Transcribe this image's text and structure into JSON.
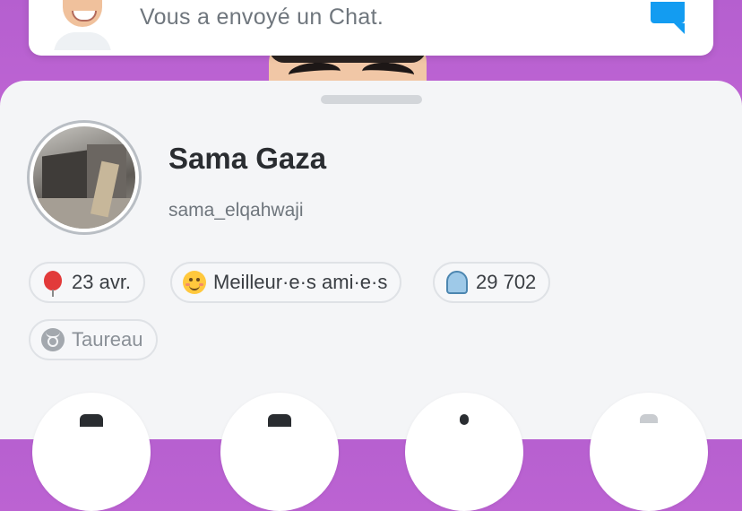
{
  "notification": {
    "text": "Vous a envoyé un Chat.",
    "icon": "chat-bubble-icon",
    "accent": "#139cf1"
  },
  "profile": {
    "display_name": "Sama Gaza",
    "username": "sama_elqahwaji"
  },
  "chips": [
    {
      "icon": "balloon-icon",
      "label": "23 avr."
    },
    {
      "icon": "smiley-icon",
      "label": "Meilleur·e·s ami·e·s"
    },
    {
      "icon": "ghost-score-icon",
      "label": "29 702"
    },
    {
      "icon": "taurus-icon",
      "label": "Taureau"
    }
  ],
  "actions": [
    {
      "icon": "action-icon-1"
    },
    {
      "icon": "action-icon-2"
    },
    {
      "icon": "action-icon-3"
    },
    {
      "icon": "action-icon-4"
    }
  ],
  "colors": {
    "background": "#c86ad8",
    "sheet": "#f4f5f7"
  }
}
